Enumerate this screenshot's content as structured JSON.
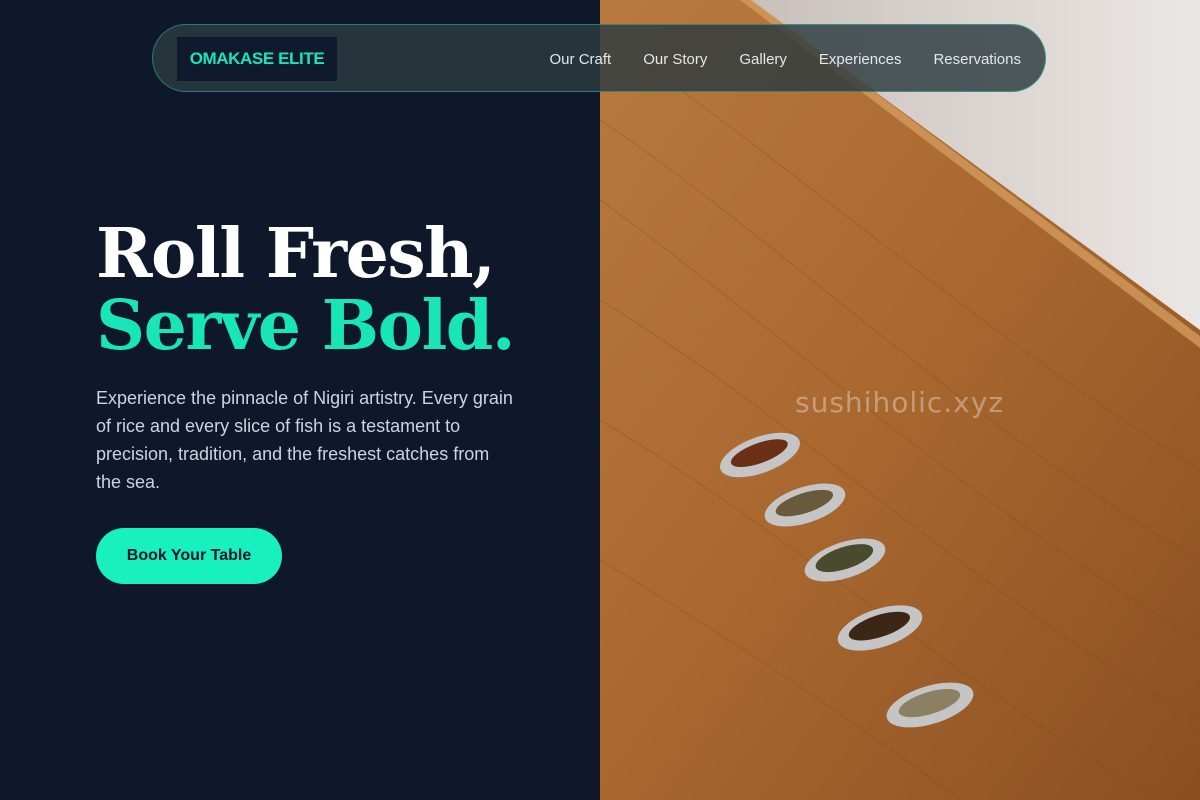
{
  "brand": {
    "name": "OMAKASE ELITE",
    "accent_color": "#19e6b8",
    "background_color": "#0f172a"
  },
  "nav": {
    "links": [
      "Our Craft",
      "Our Story",
      "Gallery",
      "Experiences",
      "Reservations"
    ]
  },
  "hero": {
    "title_line_1": "Roll Fresh,",
    "title_line_2": "Serve Bold.",
    "description": "Experience the pinnacle of Nigiri artistry. Every grain of rice and every slice of fish is a testament to precision, tradition, and the freshest catches from the sea.",
    "cta_label": "Book Your Table"
  },
  "image": {
    "subject": "five spoons of dried tea leaves on a wooden table",
    "watermark": "sushiholic.xyz"
  }
}
